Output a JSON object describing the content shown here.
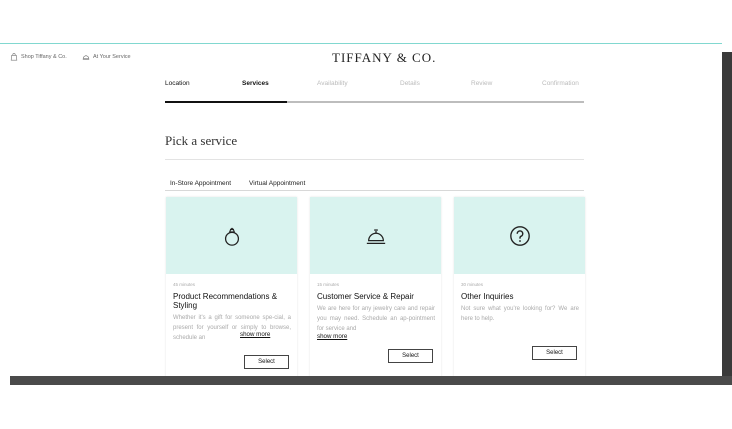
{
  "header": {
    "shop_link": "Shop Tiffany & Co.",
    "at_your_service": "At Your Service",
    "logo": "TIFFANY & CO."
  },
  "steps": [
    {
      "label": "Location",
      "state": "done"
    },
    {
      "label": "Services",
      "state": "active"
    },
    {
      "label": "Availability",
      "state": "upcoming"
    },
    {
      "label": "Details",
      "state": "upcoming"
    },
    {
      "label": "Review",
      "state": "upcoming"
    },
    {
      "label": "Confirmation",
      "state": "upcoming"
    }
  ],
  "progress_fraction": 0.29,
  "page_title": "Pick a service",
  "tabs": [
    "In-Store Appointment",
    "Virtual Appointment"
  ],
  "cards": [
    {
      "icon": "ring-icon",
      "duration": "45 minutes",
      "title": "Product Recommendations & Styling",
      "description": "Whether it's a gift for someone spe-cial, a present for yourself or simply to browse, schedule an",
      "more": "show more",
      "button": "Select"
    },
    {
      "icon": "service-bell-icon",
      "duration": "15 minutes",
      "title": "Customer Service & Repair",
      "description": "We are here for any jewelry care and repair you may need. Schedule an ap-pointment for service and",
      "more": "show more",
      "button": "Select"
    },
    {
      "icon": "question-circle-icon",
      "duration": "30 minutes",
      "title": "Other Inquiries",
      "description": "Not sure what you're looking for? We are here to help.",
      "more": "",
      "button": "Select"
    }
  ],
  "colors": {
    "accent": "#81d8d0",
    "card_header": "#d9f3ef",
    "text": "#111111",
    "muted": "#aaaaaa"
  }
}
